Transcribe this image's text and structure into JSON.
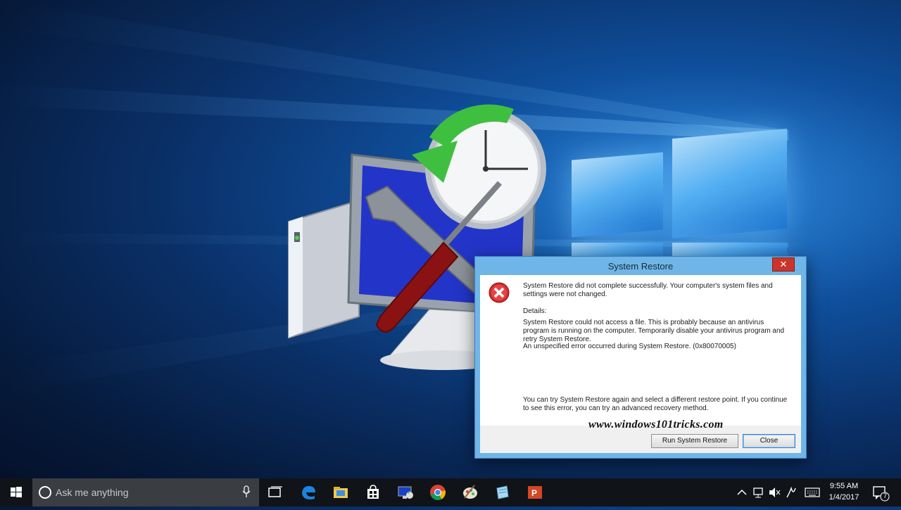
{
  "dialog": {
    "title": "System Restore",
    "close_glyph": "✕",
    "message_main": "System Restore did not complete successfully. Your computer's system files and settings were not changed.",
    "details_label": "Details:",
    "details_text": "System Restore could not access a file. This is probably because an antivirus program is running on the computer. Temporarily disable your antivirus program and retry System Restore.",
    "error_line": "An unspecified error occurred during System Restore. (0x80070005)",
    "hint": "You can try System Restore again and select a different restore point. If you continue to see this error, you can try an advanced recovery method.",
    "run_button": "Run System Restore",
    "close_button": "Close",
    "icon": "error-icon"
  },
  "watermark": "www.windows101tricks.com",
  "taskbar": {
    "search_placeholder": "Ask me anything",
    "apps": [
      "task-view-icon",
      "edge-icon",
      "file-explorer-icon",
      "store-icon",
      "system-restore-app-icon",
      "chrome-icon",
      "paint-icon",
      "notepad-icon",
      "powerpoint-icon"
    ],
    "time": "9:55 AM",
    "date": "1/4/2017",
    "notification_count": "7"
  },
  "colors": {
    "accent": "#0a5bc4",
    "error": "#c0262c",
    "taskbar": "#101318"
  }
}
